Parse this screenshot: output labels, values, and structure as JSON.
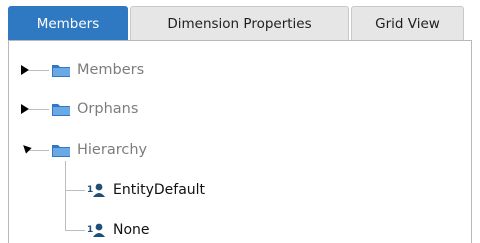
{
  "tabs": [
    {
      "label": "Members",
      "active": true
    },
    {
      "label": "Dimension Properties",
      "active": false
    },
    {
      "label": "Grid View",
      "active": false
    }
  ],
  "tree": {
    "members": {
      "label": "Members",
      "icon": "folder-icon",
      "expanded": false
    },
    "orphans": {
      "label": "Orphans",
      "icon": "folder-icon",
      "expanded": false
    },
    "hierarchy": {
      "label": "Hierarchy",
      "icon": "folder-icon",
      "expanded": true,
      "children": [
        {
          "label": "EntityDefault",
          "icon": "member-icon"
        },
        {
          "label": "None",
          "icon": "member-icon"
        }
      ]
    }
  },
  "colors": {
    "active_tab": "#2f78c2",
    "folder": "#2f78c2",
    "member_badge": "#1f4e79"
  }
}
